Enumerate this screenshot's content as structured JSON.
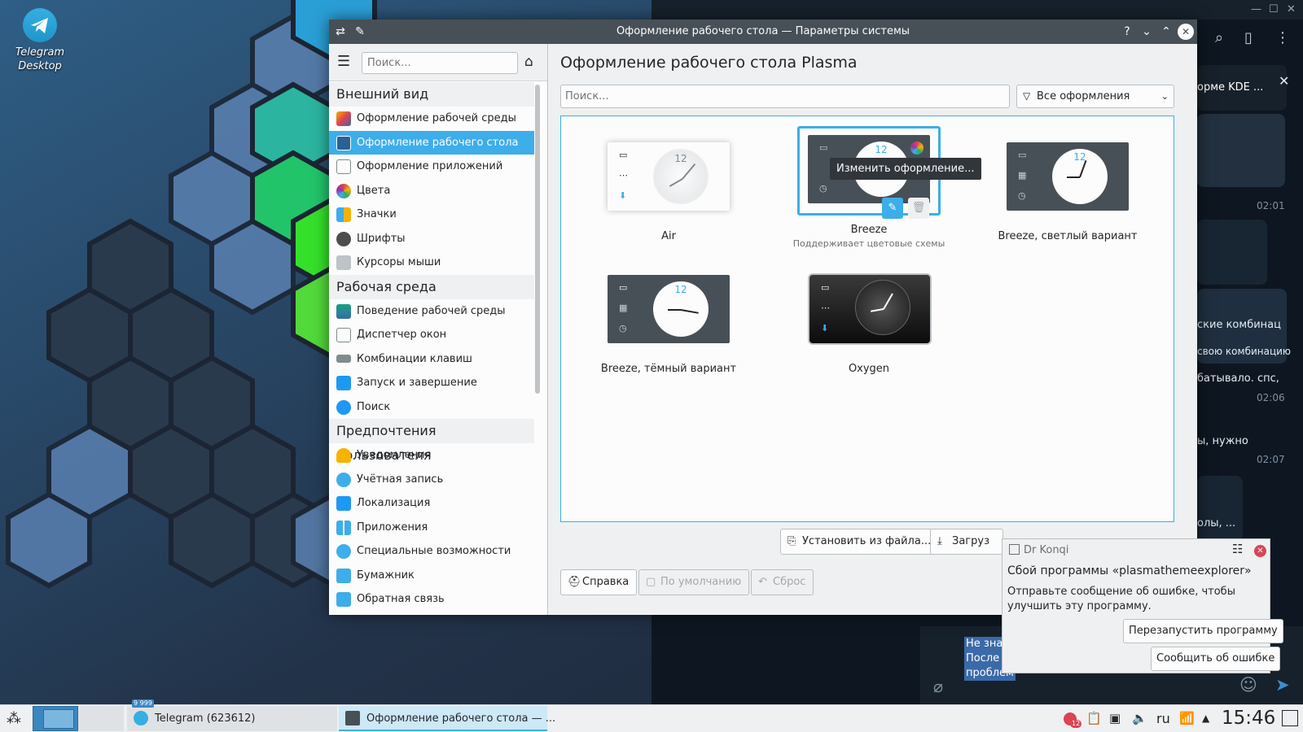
{
  "desktop": {
    "icon_label": "Telegram Desktop"
  },
  "telegram": {
    "snippets": {
      "s1": "орме KDE ...",
      "t1": "02:01",
      "s2": "ские комбинац",
      "s3": "свою комбинацию",
      "m1": "батывало. спс,",
      "t2": "02:06",
      "m2": "ы, нужно",
      "t3": "02:07",
      "m3": "олы, ...",
      "sel1": "Не знае",
      "sel2": "После у",
      "sel3": "проблем"
    }
  },
  "window": {
    "title": "Оформление рабочего стола — Параметры системы"
  },
  "sidebar": {
    "search_placeholder": "Поиск...",
    "categories": [
      {
        "label": "Внешний вид",
        "items": [
          {
            "label": "Оформление рабочей среды",
            "icon": "workspace-theme-icon",
            "color": "#e05a2a"
          },
          {
            "label": "Оформление рабочего стола",
            "icon": "desktop-theme-icon",
            "color": "#3b6aa8",
            "selected": true
          },
          {
            "label": "Оформление приложений",
            "icon": "app-style-icon",
            "color": "#7f8c8d"
          },
          {
            "label": "Цвета",
            "icon": "colors-icon",
            "color": "#9b2fae"
          },
          {
            "label": "Значки",
            "icon": "icons-icon",
            "color": "#3daee9"
          },
          {
            "label": "Шрифты",
            "icon": "fonts-icon",
            "color": "#4d4d4d"
          },
          {
            "label": "Курсоры мыши",
            "icon": "cursor-icon",
            "color": "#7f8c8d"
          }
        ]
      },
      {
        "label": "Рабочая среда",
        "items": [
          {
            "label": "Поведение рабочей среды",
            "icon": "workspace-behavior-icon",
            "color": "#16a085"
          },
          {
            "label": "Диспетчер окон",
            "icon": "window-manager-icon",
            "color": "#dfe2e5"
          },
          {
            "label": "Комбинации клавиш",
            "icon": "keyboard-icon",
            "color": "#7f8c8d"
          },
          {
            "label": "Запуск и завершение",
            "icon": "startup-icon",
            "color": "#1d99f3"
          },
          {
            "label": "Поиск",
            "icon": "search-icon",
            "color": "#1d99f3"
          }
        ]
      },
      {
        "label": "Предпочтения пользователя",
        "items": [
          {
            "label": "Уведомления",
            "icon": "bell-icon",
            "color": "#f6b300"
          },
          {
            "label": "Учётная запись",
            "icon": "user-icon",
            "color": "#3daee9"
          },
          {
            "label": "Локализация",
            "icon": "locale-icon",
            "color": "#1d99f3"
          },
          {
            "label": "Приложения",
            "icon": "apps-icon",
            "color": "#3daee9"
          },
          {
            "label": "Специальные возможности",
            "icon": "accessibility-icon",
            "color": "#3daee9"
          },
          {
            "label": "Бумажник",
            "icon": "wallet-icon",
            "color": "#3daee9"
          },
          {
            "label": "Обратная связь",
            "icon": "feedback-icon",
            "color": "#3daee9"
          }
        ]
      }
    ]
  },
  "content": {
    "title": "Оформление рабочего стола Plasma",
    "search_placeholder": "Поиск...",
    "filter_label": "Все оформления",
    "tooltip": "Изменить оформление...",
    "themes": [
      {
        "name": "Air",
        "subtitle": ""
      },
      {
        "name": "Breeze",
        "subtitle": "Поддерживает цветовые схемы"
      },
      {
        "name": "Breeze, светлый вариант",
        "subtitle": ""
      },
      {
        "name": "Breeze, тёмный вариант",
        "subtitle": ""
      },
      {
        "name": "Oxygen",
        "subtitle": ""
      }
    ],
    "buttons": {
      "install": "Установить из файла...",
      "download": "Загруз",
      "help": "Справка",
      "defaults": "По умолчанию",
      "reset": "Сброс"
    }
  },
  "konqi": {
    "app": "Dr Konqi",
    "title": "Сбой программы «plasmathemeexplorer»",
    "text": "Отправьте сообщение об ошибке, чтобы улучшить эту программу.",
    "restart": "Перезапустить программу",
    "report": "Сообщить об ошибке"
  },
  "taskbar": {
    "tasks": [
      {
        "label": "Telegram (623612)",
        "badge": "9 999"
      },
      {
        "label": "Оформление рабочего стола — ..."
      }
    ],
    "tray_badge": "12",
    "lang": "ru",
    "time": "15:46"
  }
}
